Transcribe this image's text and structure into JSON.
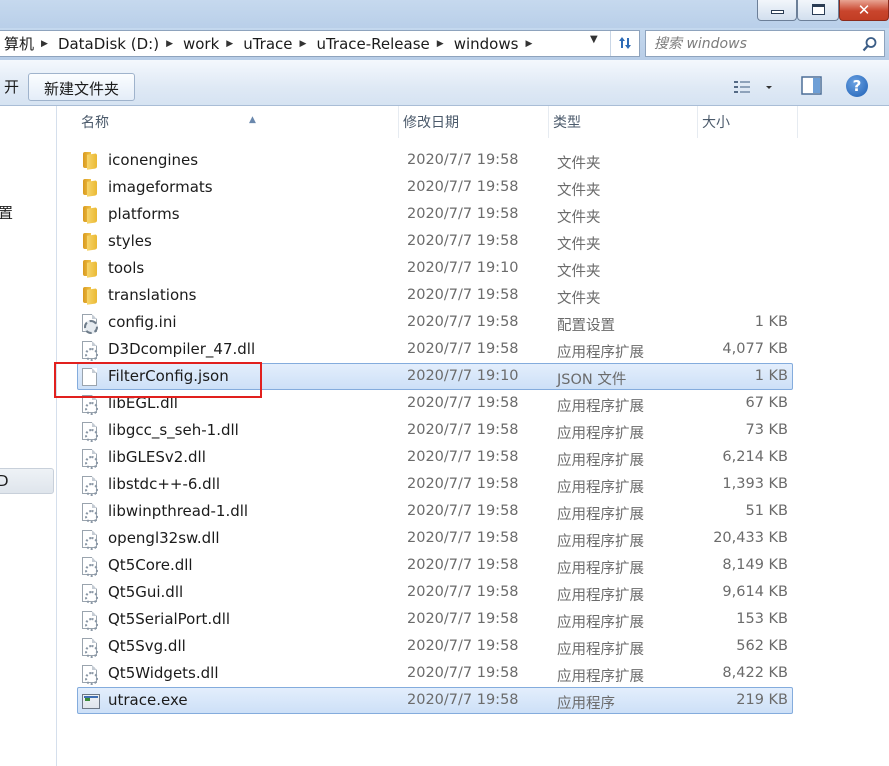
{
  "titlebar": {
    "minimize_label": "▁",
    "maximize_label": "□",
    "close_label": "✕"
  },
  "address": {
    "crumbs": [
      "算机",
      "DataDisk (D:)",
      "work",
      "uTrace",
      "uTrace-Release",
      "windows"
    ],
    "refresh_icon": "refresh-icon"
  },
  "search": {
    "placeholder": "搜索 windows"
  },
  "toolbar": {
    "open_label": "开",
    "new_folder_label": "新建文件夹",
    "help_label": "?"
  },
  "nav": {
    "item1": "置",
    "item2": "D"
  },
  "columns": {
    "name": "名称",
    "date": "修改日期",
    "type": "类型",
    "size": "大小"
  },
  "files": [
    {
      "name": "iconengines",
      "date": "2020/7/7 19:58",
      "type": "文件夹",
      "size": "",
      "icon": "folder"
    },
    {
      "name": "imageformats",
      "date": "2020/7/7 19:58",
      "type": "文件夹",
      "size": "",
      "icon": "folder"
    },
    {
      "name": "platforms",
      "date": "2020/7/7 19:58",
      "type": "文件夹",
      "size": "",
      "icon": "folder"
    },
    {
      "name": "styles",
      "date": "2020/7/7 19:58",
      "type": "文件夹",
      "size": "",
      "icon": "folder"
    },
    {
      "name": "tools",
      "date": "2020/7/7 19:10",
      "type": "文件夹",
      "size": "",
      "icon": "folder"
    },
    {
      "name": "translations",
      "date": "2020/7/7 19:58",
      "type": "文件夹",
      "size": "",
      "icon": "folder"
    },
    {
      "name": "config.ini",
      "date": "2020/7/7 19:58",
      "type": "配置设置",
      "size": "1 KB",
      "icon": "ini"
    },
    {
      "name": "D3Dcompiler_47.dll",
      "date": "2020/7/7 19:58",
      "type": "应用程序扩展",
      "size": "4,077 KB",
      "icon": "dll"
    },
    {
      "name": "FilterConfig.json",
      "date": "2020/7/7 19:10",
      "type": "JSON 文件",
      "size": "1 KB",
      "icon": "file",
      "selected": true
    },
    {
      "name": "libEGL.dll",
      "date": "2020/7/7 19:58",
      "type": "应用程序扩展",
      "size": "67 KB",
      "icon": "dll"
    },
    {
      "name": "libgcc_s_seh-1.dll",
      "date": "2020/7/7 19:58",
      "type": "应用程序扩展",
      "size": "73 KB",
      "icon": "dll"
    },
    {
      "name": "libGLESv2.dll",
      "date": "2020/7/7 19:58",
      "type": "应用程序扩展",
      "size": "6,214 KB",
      "icon": "dll"
    },
    {
      "name": "libstdc++-6.dll",
      "date": "2020/7/7 19:58",
      "type": "应用程序扩展",
      "size": "1,393 KB",
      "icon": "dll"
    },
    {
      "name": "libwinpthread-1.dll",
      "date": "2020/7/7 19:58",
      "type": "应用程序扩展",
      "size": "51 KB",
      "icon": "dll"
    },
    {
      "name": "opengl32sw.dll",
      "date": "2020/7/7 19:58",
      "type": "应用程序扩展",
      "size": "20,433 KB",
      "icon": "dll"
    },
    {
      "name": "Qt5Core.dll",
      "date": "2020/7/7 19:58",
      "type": "应用程序扩展",
      "size": "8,149 KB",
      "icon": "dll"
    },
    {
      "name": "Qt5Gui.dll",
      "date": "2020/7/7 19:58",
      "type": "应用程序扩展",
      "size": "9,614 KB",
      "icon": "dll"
    },
    {
      "name": "Qt5SerialPort.dll",
      "date": "2020/7/7 19:58",
      "type": "应用程序扩展",
      "size": "153 KB",
      "icon": "dll"
    },
    {
      "name": "Qt5Svg.dll",
      "date": "2020/7/7 19:58",
      "type": "应用程序扩展",
      "size": "562 KB",
      "icon": "dll"
    },
    {
      "name": "Qt5Widgets.dll",
      "date": "2020/7/7 19:58",
      "type": "应用程序扩展",
      "size": "8,422 KB",
      "icon": "dll"
    },
    {
      "name": "utrace.exe",
      "date": "2020/7/7 19:58",
      "type": "应用程序",
      "size": "219 KB",
      "icon": "exe",
      "selected": true
    }
  ],
  "annotation_color": "#e1201e"
}
